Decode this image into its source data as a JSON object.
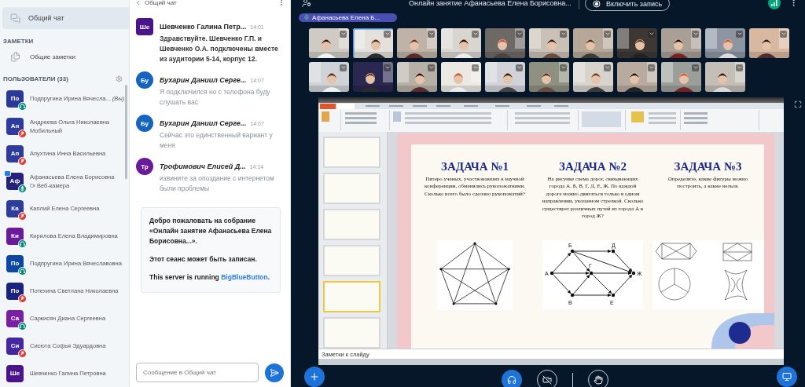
{
  "sidebar": {
    "chat_item": "Общий чат",
    "notes_heading": "ЗАМЕТКИ",
    "notes_item": "Общие заметки",
    "users_heading": "ПОЛЬЗОВАТЕЛИ (33)",
    "users": [
      {
        "initials": "По",
        "name": "Подпругина Ирина Вячесла...",
        "you": "(Вы)",
        "color": "#2b3a98",
        "muted": false,
        "listen_only": true,
        "presenter": false
      },
      {
        "initials": "Ан",
        "name": "Андреева Ольга Николаевна",
        "sub": "Мобильный",
        "color": "#2e3d9c",
        "muted": true,
        "listen_only": false,
        "presenter": false
      },
      {
        "initials": "Ап",
        "name": "Апухтина Инна Васильевна",
        "color": "#2e3d9c",
        "muted": true,
        "listen_only": false,
        "presenter": false
      },
      {
        "initials": "Аф",
        "name": "Афанасьева Елена Борисовна",
        "sub": "Веб-камера",
        "color": "#26217a",
        "muted": false,
        "listen_only": false,
        "presenter": true
      },
      {
        "initials": "Ка",
        "name": "Каплий Елена Сергеевна",
        "color": "#2e3d9c",
        "muted": true,
        "listen_only": false,
        "presenter": false
      },
      {
        "initials": "Ки",
        "name": "Кирилова Елена Владимировна",
        "color": "#6a1b9a",
        "muted": false,
        "listen_only": true,
        "presenter": false
      },
      {
        "initials": "По",
        "name": "Подпругина Ирина Вячеславовна",
        "color": "#0d47a1",
        "muted": false,
        "listen_only": true,
        "presenter": false
      },
      {
        "initials": "По",
        "name": "Потехина Светлана Николаевна",
        "color": "#1a237e",
        "muted": true,
        "listen_only": false,
        "presenter": false
      },
      {
        "initials": "Са",
        "name": "Саркисян Диана Сергеевна",
        "color": "#7b1fa2",
        "muted": false,
        "listen_only": true,
        "presenter": false
      },
      {
        "initials": "Си",
        "name": "Сисюта Софья Эдуардовна",
        "color": "#4527a0",
        "muted": true,
        "listen_only": false,
        "presenter": false
      },
      {
        "initials": "Ше",
        "name": "Шевченко Галина Петровна",
        "color": "#4a148c"
      }
    ]
  },
  "chat": {
    "title": "Общий чат",
    "messages": [
      {
        "initials": "Ше",
        "name": "Шевченко Галина Петр...",
        "time": "14:01",
        "text": "Здравствуйте. Шевченко Г.П. и Шевченко О.А. подключены вместе из аудитории 5-14, корпус 12.",
        "moderator": true,
        "color": "#4a148c"
      },
      {
        "initials": "Бу",
        "name": "Бухарин Даниил Серге...",
        "time": "14:07",
        "text": "Я подключился но с телефона буду слушать вас",
        "moderator": false,
        "color": "#1565c0"
      },
      {
        "initials": "Бу",
        "name": "Бухарин Даниил Серге...",
        "time": "14:07",
        "text": "Сейчас это единственный вариант у меня",
        "moderator": false,
        "color": "#1565c0"
      },
      {
        "initials": "Тр",
        "name": "Трофимович Елисей Д...",
        "time": "14:14",
        "text": "извините за опоздание с интернетом были проблемы",
        "moderator": false,
        "color": "#6a1b9a"
      }
    ],
    "welcome": {
      "greeting": "Добро пожаловать на собрание «Онлайн занятие Афанасьева Елена Борисовна...».",
      "note": "Этот сеанс может быть записан.",
      "server_text": "This server is running",
      "link": "BigBlueButton",
      "suffix": "."
    },
    "input": {
      "placeholder": "Сообщение в Общий чат"
    }
  },
  "meeting": {
    "title": "Онлайн занятие Афанасьева Елена Борисовна...",
    "record_button": "Включить запись",
    "talker": "Афанасьева Елена Б...",
    "videos": [
      {
        "kind": "picture",
        "talking": false
      },
      {
        "kind": "picture",
        "talking": true
      },
      {
        "kind": "picture",
        "talking": false
      },
      {
        "kind": "picture",
        "talking": false
      },
      {
        "kind": "picture",
        "talking": false
      },
      {
        "kind": "picture",
        "talking": false
      },
      {
        "kind": "picture",
        "talking": false
      },
      {
        "kind": "picture",
        "talking": false
      },
      {
        "kind": "picture",
        "talking": false
      },
      {
        "kind": "picture",
        "talking": false
      },
      {
        "kind": "picture",
        "talking": false
      },
      {
        "kind": "picture",
        "talking": false
      },
      {
        "kind": "picture",
        "talking": false
      },
      {
        "kind": "picture",
        "talking": false
      },
      {
        "kind": "picture",
        "talking": false
      },
      {
        "kind": "picture",
        "talking": false
      },
      {
        "kind": "picture",
        "talking": false
      },
      {
        "kind": "picture",
        "talking": false
      },
      {
        "kind": "picture",
        "talking": false
      },
      {
        "kind": "picture",
        "talking": false
      },
      {
        "kind": "picture",
        "talking": false
      }
    ]
  },
  "presentation": {
    "thumbnails": [
      {
        "selected": false
      },
      {
        "selected": false
      },
      {
        "selected": false
      },
      {
        "selected": false
      },
      {
        "selected": true
      },
      {
        "selected": false
      }
    ],
    "tasks": [
      {
        "title": "ЗАДАЧА №1",
        "text": "Пятеро ученых, участвовавших в научной конференции, обменялись рукопожатиями. Сколько всего было сделано рукопожатий?",
        "kind": "pentagram"
      },
      {
        "title": "ЗАДАЧА №2",
        "text": "На рисунке   схема дорог, связывающих города А, Б, В, Г, Д, Е, Ж. По каждой дороге можно двигаться только в одном направлении, указанном стрелкой. Сколько существует различных путей из города А в город Ж?",
        "kind": "graph",
        "nodes": [
          "А",
          "Б",
          "Д",
          "Г",
          "Ж",
          "В",
          "Е"
        ]
      },
      {
        "title": "ЗАДАЧА №3",
        "text": "Определите, какие фигуры можно построить, а какие нельзя.",
        "kind": "shapes"
      }
    ],
    "notes": "Заметки к слайду"
  }
}
